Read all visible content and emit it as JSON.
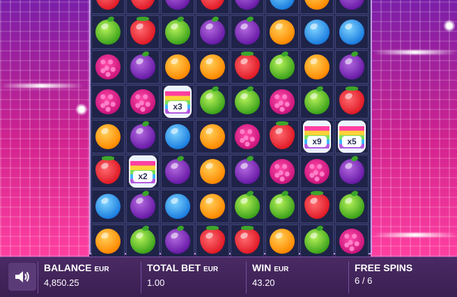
{
  "board": {
    "rows": 7,
    "cols": 8,
    "cells": [
      [
        "strawberry",
        "strawberry",
        "plum",
        "strawberry",
        "plum",
        "blueberry",
        "orange",
        "plum"
      ],
      [
        "apple",
        "strawberry",
        "apple",
        "plum",
        "plum",
        "orange",
        "blueberry",
        "blueberry"
      ],
      [
        "raspberry",
        "plum",
        "orange",
        "orange",
        "strawberry",
        "apple",
        "orange",
        "plum"
      ],
      [
        "raspberry",
        "raspberry",
        "jar",
        "apple",
        "apple",
        "raspberry",
        "apple",
        "strawberry"
      ],
      [
        "orange",
        "plum",
        "blueberry",
        "orange",
        "raspberry",
        "strawberry",
        "jar",
        "jar"
      ],
      [
        "strawberry",
        "jar",
        "plum",
        "orange",
        "plum",
        "raspberry",
        "raspberry",
        "plum"
      ],
      [
        "blueberry",
        "plum",
        "blueberry",
        "orange",
        "apple",
        "apple",
        "strawberry",
        "apple"
      ],
      [
        "orange",
        "apple",
        "plum",
        "strawberry",
        "strawberry",
        "orange",
        "apple",
        "raspberry"
      ]
    ],
    "jars": {
      "3-2": "x3",
      "4-6": "x9",
      "4-7": "x5",
      "5-1": "x2"
    }
  },
  "bottom_bar": {
    "sound_icon": "speaker-icon",
    "balance": {
      "label": "BALANCE",
      "unit": "EUR",
      "value": "4,850.25"
    },
    "total_bet": {
      "label": "TOTAL BET",
      "unit": "EUR",
      "value": "1.00"
    },
    "win": {
      "label": "WIN",
      "unit": "EUR",
      "value": "43.20"
    },
    "free_spins": {
      "label": "FREE SPINS",
      "value": "6 / 6"
    }
  },
  "colors": {
    "board_bg": "#2b2f58",
    "board_border": "#c69be8",
    "bar_bg": "#4a2a63"
  }
}
